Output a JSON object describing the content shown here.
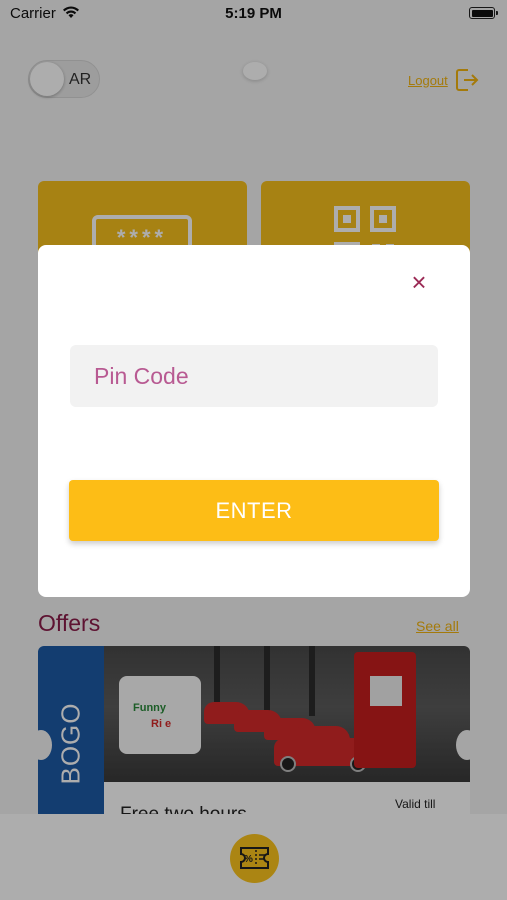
{
  "status_bar": {
    "carrier": "Carrier",
    "time": "5:19 PM"
  },
  "header": {
    "language_label": "AR",
    "logout_label": "Logout"
  },
  "offers": {
    "title": "Offers",
    "see_all_label": "See all",
    "card": {
      "ribbon": "BOGO",
      "logo_line1": "Funny",
      "logo_line2": "Ri  e",
      "title": "Free two hours",
      "valid_label": "Valid till"
    }
  },
  "pin_modal": {
    "placeholder": "Pin Code",
    "value": "",
    "enter_label": "ENTER",
    "close_symbol": "×"
  },
  "colors": {
    "accent_yellow": "#fdbd16",
    "brand_maroon": "#8b1d4a",
    "ribbon_blue": "#1d5aa6"
  },
  "icons": {
    "wifi": "wifi-icon",
    "battery": "battery-icon",
    "logout": "logout-icon",
    "pin_tile": "pin-code-icon",
    "qr_tile": "qr-code-icon",
    "close": "close-icon",
    "coupon": "coupon-icon"
  }
}
